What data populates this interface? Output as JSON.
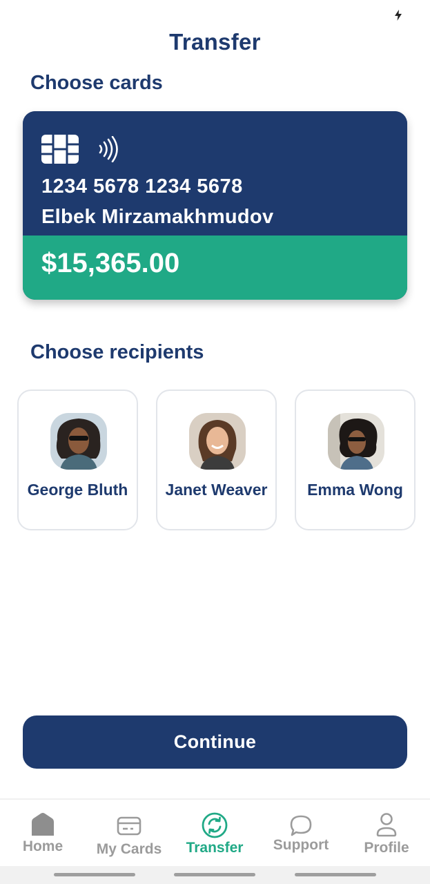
{
  "status_bar": {
    "icon": "charging-icon"
  },
  "header": {
    "title": "Transfer"
  },
  "cards_section": {
    "title": "Choose cards",
    "card": {
      "number": "1234 5678 1234 5678",
      "holder": "Elbek Mirzamakhmudov",
      "balance": "$15,365.00",
      "icons": [
        "chip-icon",
        "contactless-icon"
      ],
      "colors": {
        "top": "#1e3a6e",
        "bottom": "#20a986"
      }
    }
  },
  "recipients_section": {
    "title": "Choose recipients",
    "items": [
      {
        "name": "George Bluth",
        "avatar": "avatar-photo"
      },
      {
        "name": "Janet Weaver",
        "avatar": "avatar-photo"
      },
      {
        "name": "Emma Wong",
        "avatar": "avatar-photo"
      }
    ]
  },
  "continue_button": {
    "label": "Continue"
  },
  "bottom_nav": {
    "items": [
      {
        "label": "Home",
        "icon": "home-icon",
        "active": false
      },
      {
        "label": "My Cards",
        "icon": "card-icon",
        "active": false
      },
      {
        "label": "Transfer",
        "icon": "transfer-icon",
        "active": true
      },
      {
        "label": "Support",
        "icon": "chat-bubble-icon",
        "active": false
      },
      {
        "label": "Profile",
        "icon": "user-icon",
        "active": false
      }
    ]
  },
  "colors": {
    "primary": "#1e3a6e",
    "accent": "#20a986",
    "inactive": "#9b9b9b",
    "border": "#e2e5ea"
  }
}
